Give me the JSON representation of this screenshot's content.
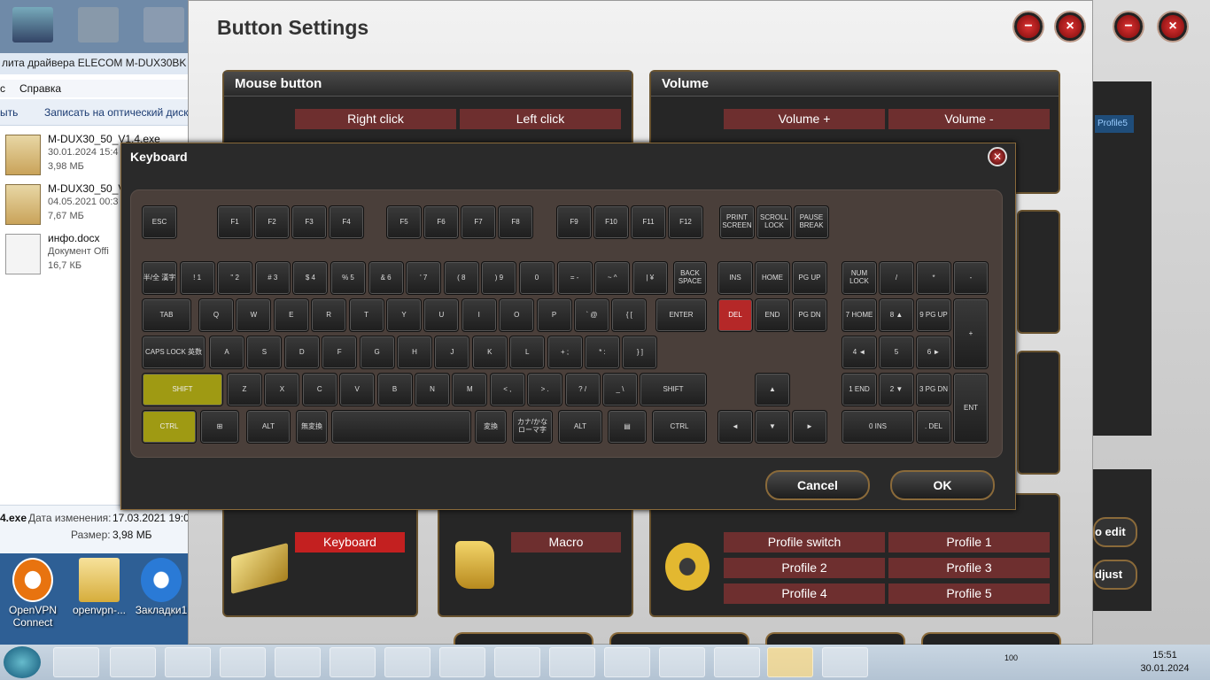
{
  "explorer": {
    "title": "лита драйвера ELECOM M-DUX30BK  M",
    "menu": [
      "с",
      "Справка"
    ],
    "toolbar": [
      "ыть",
      "Записать на оптический диск"
    ],
    "files": [
      {
        "name": "M-DUX30_50_V1.4.exe",
        "date": "30.01.2024 15:4",
        "size": "3,98 МБ"
      },
      {
        "name": "M-DUX30_50_V",
        "date": "04.05.2021 00:3",
        "size": "7,67 МБ"
      },
      {
        "name": "инфо.docx",
        "date": "Документ Offi",
        "size": "16,7 КБ"
      }
    ],
    "status": {
      "file": "4.exe",
      "date_label": "Дата изменения:",
      "date_value": "17.03.2021 19:06",
      "size_label": "Размер:",
      "size_value": "3,98 МБ"
    }
  },
  "desktop_icons": [
    {
      "label": "OpenVPN Connect"
    },
    {
      "label": "openvpn-..."
    },
    {
      "label": "Закладки1"
    }
  ],
  "main": {
    "title": "Button Settings",
    "panels": {
      "mouse": {
        "title": "Mouse button",
        "buttons": [
          "Right click",
          "Left click"
        ]
      },
      "volume": {
        "title": "Volume",
        "buttons": [
          "Volume +",
          "Volume -"
        ]
      },
      "keyboard": {
        "button": "Keyboard"
      },
      "macro": {
        "button": "Macro"
      },
      "profile": {
        "buttons": [
          "Profile switch",
          "Profile 1",
          "Profile 2",
          "Profile 3",
          "Profile 4",
          "Profile 5"
        ]
      }
    },
    "back_window": {
      "profile_badge": "Profile5",
      "edit": "o edit",
      "adjust": "djust"
    }
  },
  "keyboard_dialog": {
    "title": "Keyboard",
    "cancel": "Cancel",
    "ok": "OK",
    "rows": {
      "fn": [
        "ESC",
        "F1",
        "F2",
        "F3",
        "F4",
        "F5",
        "F6",
        "F7",
        "F8",
        "F9",
        "F10",
        "F11",
        "F12",
        "PRINT SCREEN",
        "SCROLL LOCK",
        "PAUSE BREAK"
      ],
      "num": [
        "半/全 漢字",
        "! 1",
        "\" 2",
        "# 3",
        "$ 4",
        "% 5",
        "& 6",
        "' 7",
        "( 8",
        ") 9",
        "0",
        "= -",
        "~ ^",
        "| ¥",
        "BACK SPACE"
      ],
      "tab": [
        "TAB",
        "Q",
        "W",
        "E",
        "R",
        "T",
        "Y",
        "U",
        "I",
        "O",
        "P",
        "` @",
        "{ [",
        "ENTER"
      ],
      "caps": [
        "CAPS LOCK 英数",
        "A",
        "S",
        "D",
        "F",
        "G",
        "H",
        "J",
        "K",
        "L",
        "+ ;",
        "* :",
        "} ]"
      ],
      "shift": [
        "SHIFT",
        "Z",
        "X",
        "C",
        "V",
        "B",
        "N",
        "M",
        "< ,",
        "> .",
        "? /",
        "_ \\",
        "SHIFT"
      ],
      "ctrl": [
        "CTRL",
        "⊞",
        "ALT",
        "無変換",
        "",
        "変換",
        "カナ/かな ローマ字",
        "ALT",
        "▤",
        "CTRL"
      ],
      "nav": [
        "INS",
        "HOME",
        "PG UP",
        "DEL",
        "END",
        "PG DN",
        "▲",
        "◄",
        "▼",
        "►"
      ],
      "numpad": [
        "NUM LOCK",
        "/",
        "*",
        "-",
        "7 HOME",
        "8 ▲",
        "9 PG UP",
        "+",
        "4 ◄",
        "5",
        "6 ►",
        "1 END",
        "2 ▼",
        "3 PG DN",
        "ENT",
        "0 INS",
        ". DEL"
      ]
    }
  },
  "taskbar": {
    "tray_text": "100",
    "time": "15:51",
    "date": "30.01.2024"
  },
  "colors": {
    "accent_red": "#c32020",
    "button_red": "#6e2f2f",
    "highlight_yellow": "#9f9a13",
    "frame_gold": "#8a6a3a"
  }
}
